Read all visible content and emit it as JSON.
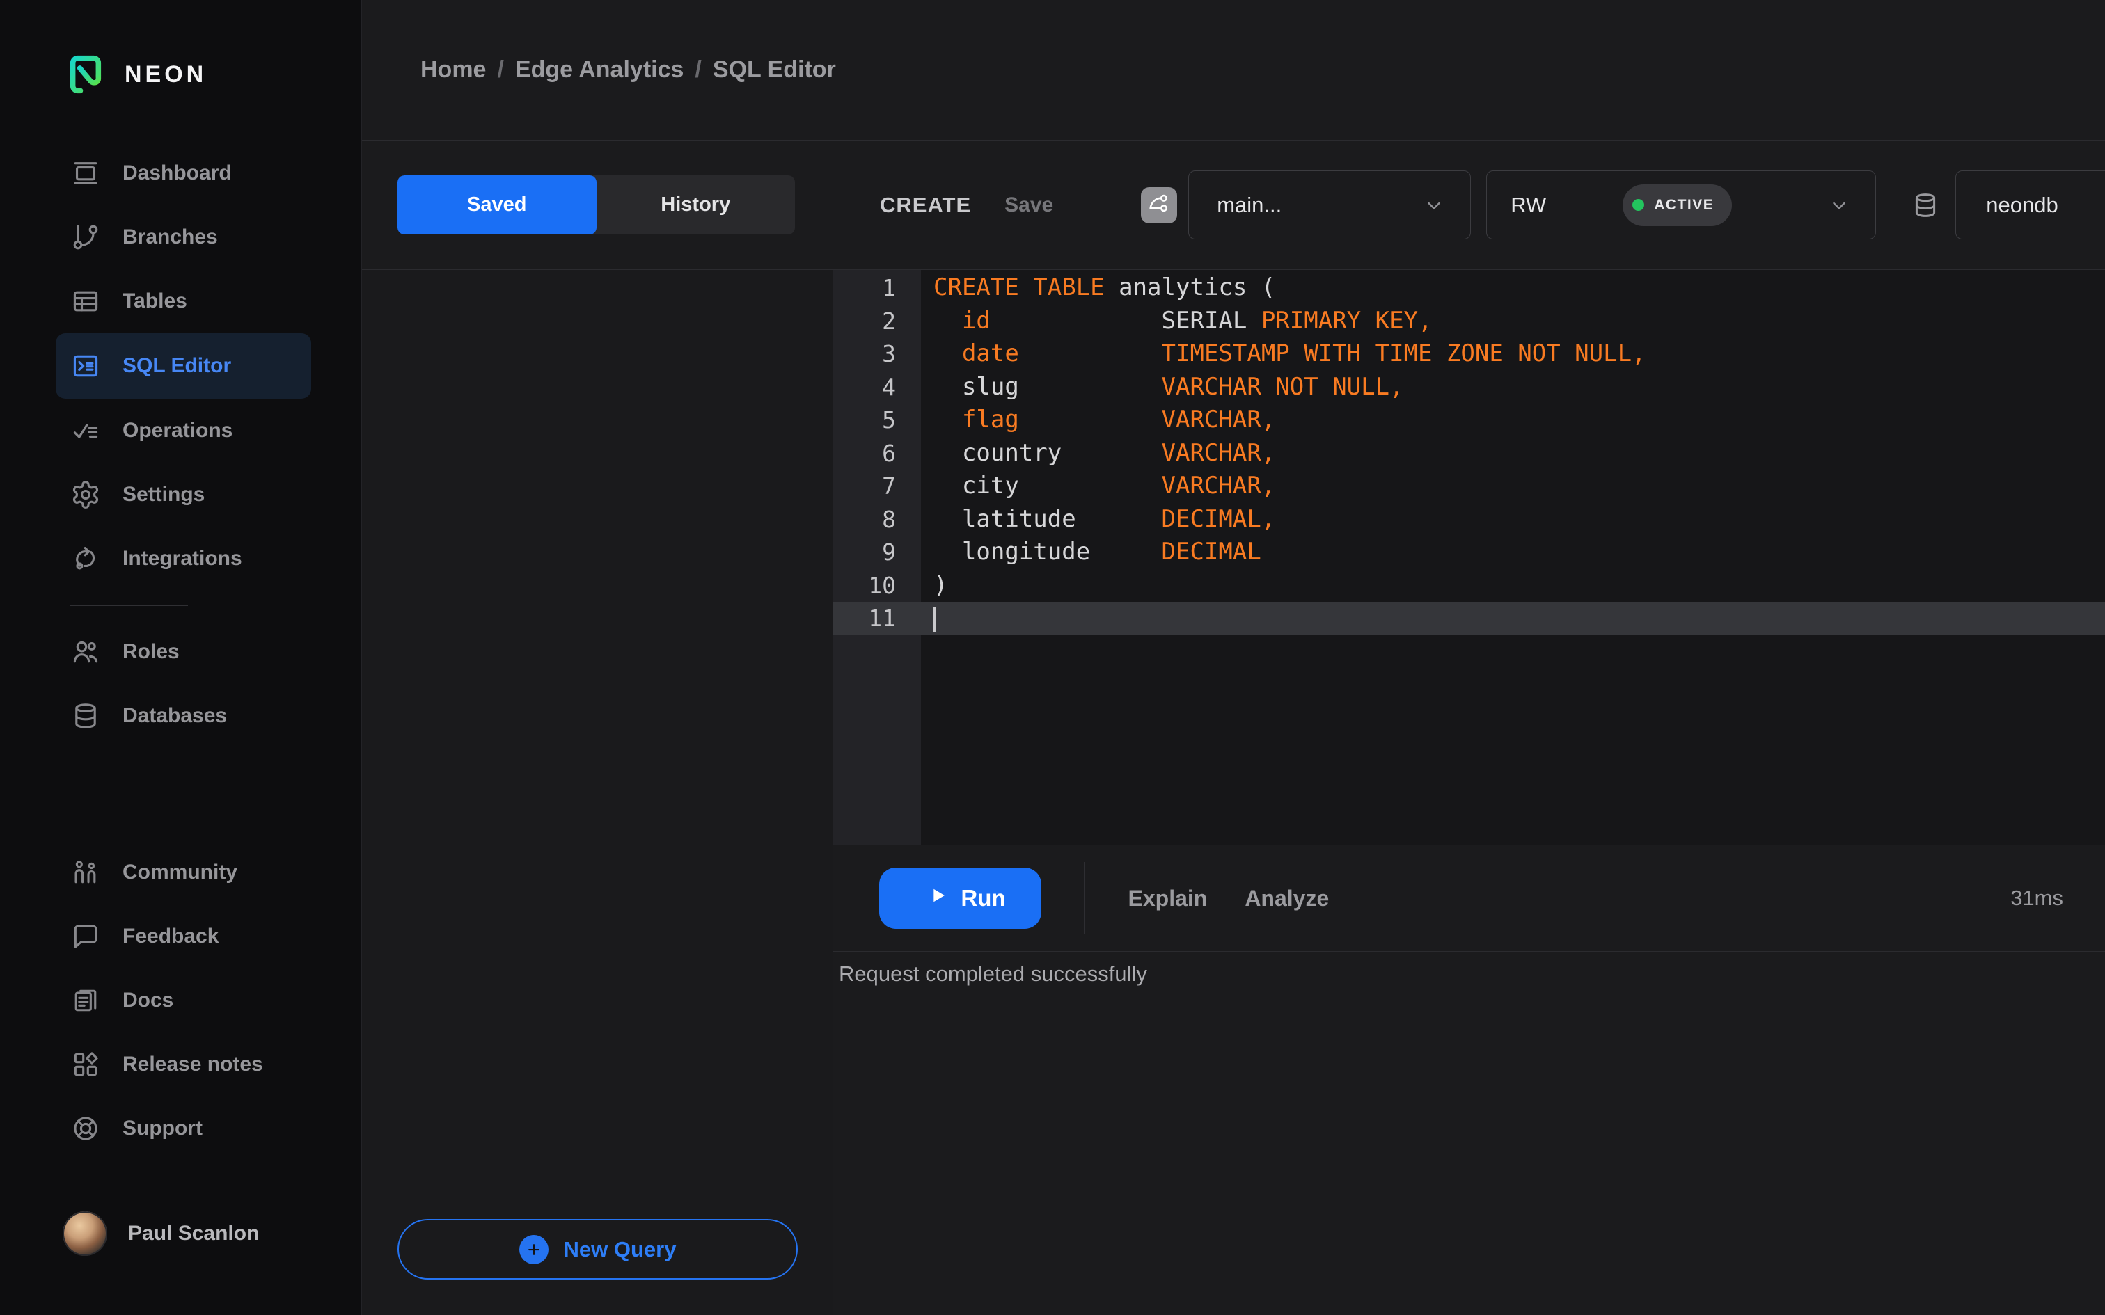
{
  "brand": {
    "name": "NEON"
  },
  "colors": {
    "accent_blue": "#1A6FF5",
    "syntax_orange": "#F97B22",
    "status_green": "#23C55E",
    "active_nav_blue": "#4787F5"
  },
  "sidebar": {
    "primary": [
      {
        "icon": "dashboard",
        "label": "Dashboard"
      },
      {
        "icon": "git-branch",
        "label": "Branches"
      },
      {
        "icon": "table",
        "label": "Tables"
      },
      {
        "icon": "terminal",
        "label": "SQL Editor",
        "active": true
      },
      {
        "icon": "operations-check",
        "label": "Operations"
      },
      {
        "icon": "gear",
        "label": "Settings"
      },
      {
        "icon": "integrations-loop",
        "label": "Integrations"
      }
    ],
    "secondary": [
      {
        "icon": "users",
        "label": "Roles"
      },
      {
        "icon": "database",
        "label": "Databases"
      }
    ],
    "tertiary": [
      {
        "icon": "community",
        "label": "Community"
      },
      {
        "icon": "speech-bubble",
        "label": "Feedback"
      },
      {
        "icon": "docs",
        "label": "Docs"
      },
      {
        "icon": "release-grid",
        "label": "Release notes"
      },
      {
        "icon": "lifebuoy",
        "label": "Support"
      }
    ],
    "user": {
      "name": "Paul Scanlon"
    }
  },
  "breadcrumb": {
    "items": [
      "Home",
      "Edge Analytics",
      "SQL Editor"
    ],
    "separator": "/"
  },
  "tabs": {
    "saved": "Saved",
    "history": "History"
  },
  "editor_header": {
    "query_title": "CREATE",
    "save_label": "Save",
    "branch": "main...",
    "compute": "RW",
    "compute_status": "ACTIVE",
    "database": "neondb"
  },
  "icons": {
    "branch_button": "git-branch-badge",
    "chevron": "chevron-down",
    "database": "database",
    "play": "play",
    "plus": "plus"
  },
  "code": {
    "active_line": 11,
    "lines": [
      {
        "num": 1,
        "segs": [
          [
            "CREATE TABLE",
            "k"
          ],
          [
            " analytics (",
            "p"
          ]
        ]
      },
      {
        "num": 2,
        "segs": [
          [
            "  ",
            "p"
          ],
          [
            "id",
            "k"
          ],
          [
            "            ",
            "p"
          ],
          [
            "SERIAL ",
            "p"
          ],
          [
            "PRIMARY KEY,",
            "k"
          ]
        ]
      },
      {
        "num": 3,
        "segs": [
          [
            "  ",
            "p"
          ],
          [
            "date",
            "k"
          ],
          [
            "          ",
            "p"
          ],
          [
            "TIMESTAMP WITH TIME ZONE NOT NULL,",
            "k"
          ]
        ]
      },
      {
        "num": 4,
        "segs": [
          [
            "  slug          ",
            "p"
          ],
          [
            "VARCHAR NOT NULL,",
            "k"
          ]
        ]
      },
      {
        "num": 5,
        "segs": [
          [
            "  ",
            "p"
          ],
          [
            "flag",
            "k"
          ],
          [
            "          ",
            "p"
          ],
          [
            "VARCHAR,",
            "k"
          ]
        ]
      },
      {
        "num": 6,
        "segs": [
          [
            "  country       ",
            "p"
          ],
          [
            "VARCHAR,",
            "k"
          ]
        ]
      },
      {
        "num": 7,
        "segs": [
          [
            "  city          ",
            "p"
          ],
          [
            "VARCHAR,",
            "k"
          ]
        ]
      },
      {
        "num": 8,
        "segs": [
          [
            "  latitude      ",
            "p"
          ],
          [
            "DECIMAL,",
            "k"
          ]
        ]
      },
      {
        "num": 9,
        "segs": [
          [
            "  longitude     ",
            "p"
          ],
          [
            "DECIMAL",
            "k"
          ]
        ]
      },
      {
        "num": 10,
        "segs": [
          [
            ")",
            "p"
          ]
        ]
      },
      {
        "num": 11,
        "segs": [],
        "cursor": true
      }
    ]
  },
  "run_bar": {
    "run": "Run",
    "explain": "Explain",
    "analyze": "Analyze",
    "duration": "31ms"
  },
  "status": {
    "message": "Request completed successfully"
  },
  "saved_panel": {
    "new_query": "New Query"
  }
}
